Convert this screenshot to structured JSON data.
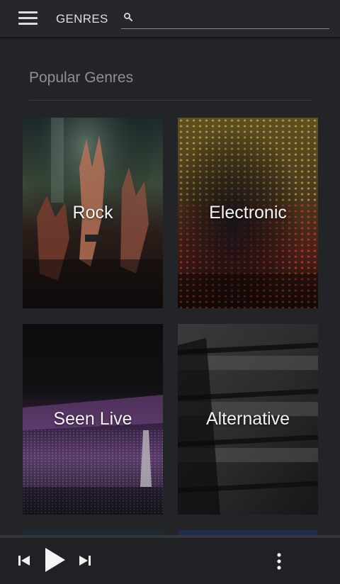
{
  "header": {
    "title": "GENRES",
    "search_placeholder": "",
    "search_value": ""
  },
  "section": {
    "title": "Popular Genres"
  },
  "genres": [
    {
      "label": "Rock"
    },
    {
      "label": "Electronic"
    },
    {
      "label": "Seen Live"
    },
    {
      "label": "Alternative"
    }
  ],
  "player": {
    "controls": [
      "skip-previous-icon",
      "play-icon",
      "skip-next-icon",
      "more-vert-icon"
    ]
  },
  "colors": {
    "appbar": "#26272b",
    "background": "#232427",
    "section_title": "#8f9094",
    "player_bg": "#202124"
  }
}
